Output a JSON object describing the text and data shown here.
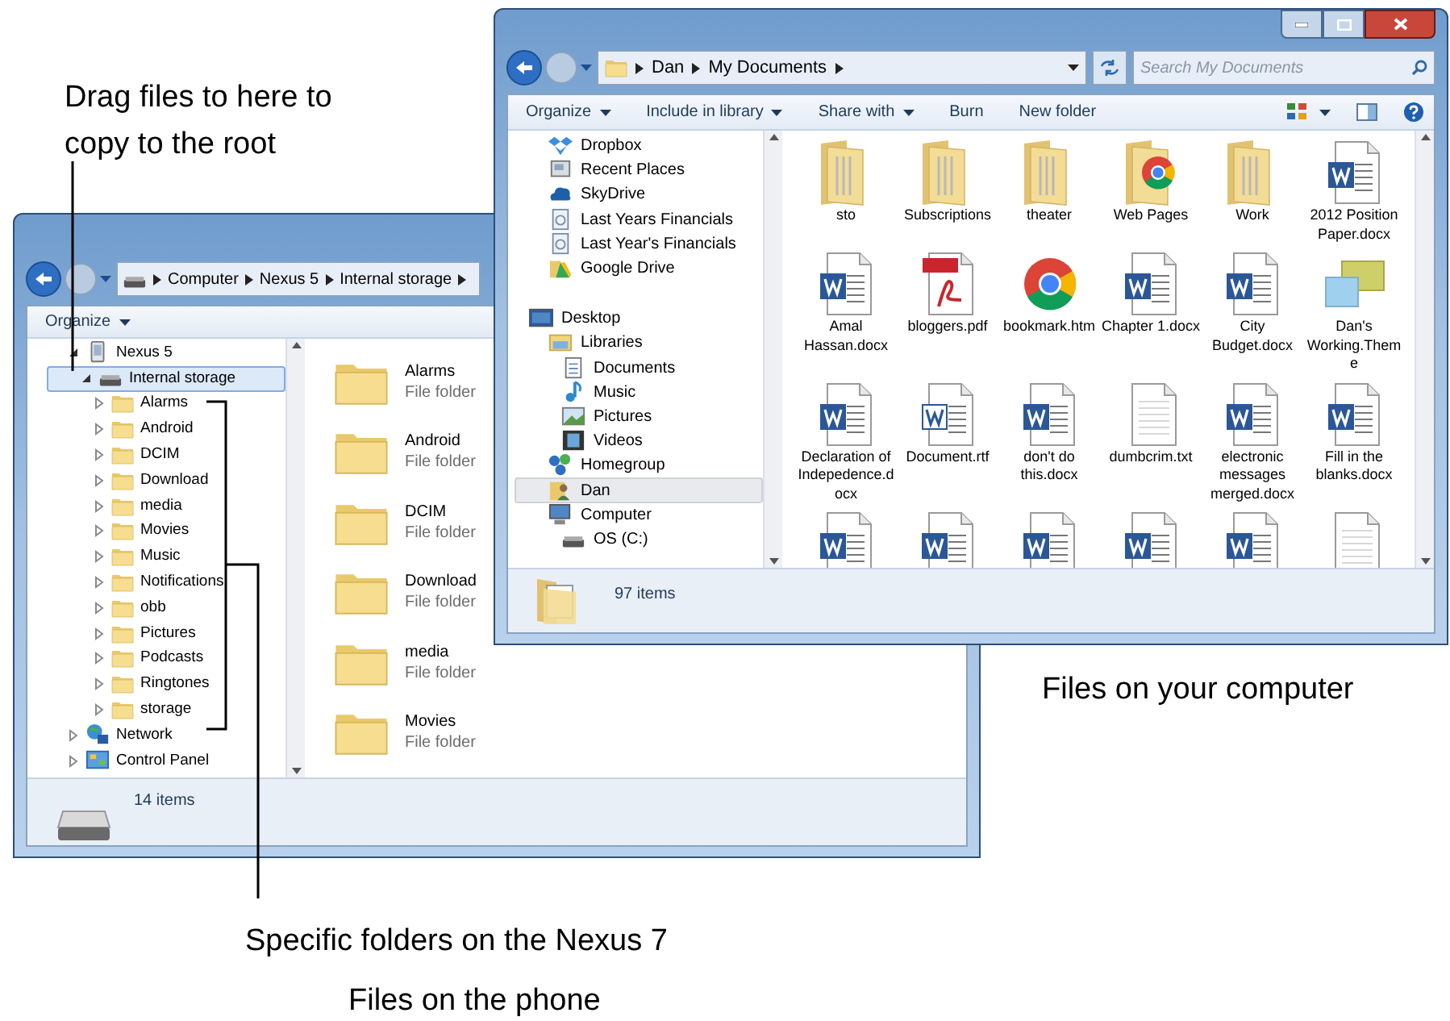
{
  "callouts": [
    {
      "text": "Drag files to here to copy to the root"
    },
    {
      "text": "Files on your computer"
    },
    {
      "text": "Specific folders on the Nexus 7"
    },
    {
      "text": "Files on the phone"
    }
  ],
  "phone_window": {
    "breadcrumb": [
      "Computer",
      "Nexus 5",
      "Internal storage"
    ],
    "toolbar": [
      {
        "label": "Organize",
        "menu": true
      }
    ],
    "nav_tree": [
      {
        "label": "Nexus 5",
        "kind": "phone",
        "expanded": true,
        "selected": false,
        "children": [
          {
            "label": "Internal storage",
            "kind": "drive",
            "expanded": true,
            "selected": true,
            "children": [
              {
                "label": "Alarms",
                "kind": "folder",
                "expanded": false,
                "selected": false
              },
              {
                "label": "Android",
                "kind": "folder",
                "expanded": false,
                "selected": false
              },
              {
                "label": "DCIM",
                "kind": "folder",
                "expanded": false,
                "selected": false
              },
              {
                "label": "Download",
                "kind": "folder",
                "expanded": false,
                "selected": false
              },
              {
                "label": "media",
                "kind": "folder",
                "expanded": false,
                "selected": false
              },
              {
                "label": "Movies",
                "kind": "folder",
                "expanded": false,
                "selected": false
              },
              {
                "label": "Music",
                "kind": "folder",
                "expanded": false,
                "selected": false
              },
              {
                "label": "Notifications",
                "kind": "folder",
                "expanded": false,
                "selected": false
              },
              {
                "label": "obb",
                "kind": "folder",
                "expanded": false,
                "selected": false
              },
              {
                "label": "Pictures",
                "kind": "folder",
                "expanded": false,
                "selected": false
              },
              {
                "label": "Podcasts",
                "kind": "folder",
                "expanded": false,
                "selected": false
              },
              {
                "label": "Ringtones",
                "kind": "folder",
                "expanded": false,
                "selected": false
              },
              {
                "label": "storage",
                "kind": "folder",
                "expanded": false,
                "selected": false
              }
            ]
          }
        ]
      },
      {
        "label": "Network",
        "kind": "network",
        "expanded": false,
        "selected": false
      },
      {
        "label": "Control Panel",
        "kind": "control-panel",
        "expanded": false,
        "selected": false
      }
    ],
    "items": [
      {
        "name": "Alarms",
        "type": "File folder"
      },
      {
        "name": "Android",
        "type": "File folder"
      },
      {
        "name": "DCIM",
        "type": "File folder"
      },
      {
        "name": "Download",
        "type": "File folder"
      },
      {
        "name": "media",
        "type": "File folder"
      },
      {
        "name": "Movies",
        "type": "File folder"
      }
    ],
    "status": "14 items"
  },
  "computer_window": {
    "breadcrumb": [
      "Dan",
      "My Documents"
    ],
    "search": {
      "placeholder": "Search My Documents"
    },
    "toolbar": [
      {
        "label": "Organize",
        "menu": true
      },
      {
        "label": "Include in library",
        "menu": true
      },
      {
        "label": "Share with",
        "menu": true
      },
      {
        "label": "Burn",
        "menu": false
      },
      {
        "label": "New folder",
        "menu": false
      }
    ],
    "nav": [
      {
        "items": [
          {
            "label": "Dropbox",
            "kind": "dropbox",
            "selected": false
          },
          {
            "label": "Recent Places",
            "kind": "recent",
            "selected": false
          },
          {
            "label": "SkyDrive",
            "kind": "cloud",
            "selected": false
          },
          {
            "label": "Last Years Financials",
            "kind": "shortcut",
            "selected": false
          },
          {
            "label": "Last Year's Financials",
            "kind": "shortcut",
            "selected": false
          },
          {
            "label": "Google Drive",
            "kind": "gdrive",
            "selected": false
          }
        ]
      },
      {
        "items": [
          {
            "label": "Desktop",
            "kind": "desktop",
            "selected": false
          },
          {
            "label": "Libraries",
            "kind": "library",
            "selected": false,
            "children": [
              {
                "label": "Documents",
                "kind": "documents",
                "selected": false
              },
              {
                "label": "Music",
                "kind": "music",
                "selected": false
              },
              {
                "label": "Pictures",
                "kind": "pictures",
                "selected": false
              },
              {
                "label": "Videos",
                "kind": "videos",
                "selected": false
              }
            ]
          },
          {
            "label": "Homegroup",
            "kind": "homegroup",
            "selected": false
          },
          {
            "label": "Dan",
            "kind": "user",
            "selected": true
          },
          {
            "label": "Computer",
            "kind": "computer",
            "selected": false,
            "children": [
              {
                "label": "OS (C:)",
                "kind": "drive",
                "selected": false
              }
            ]
          }
        ]
      }
    ],
    "items": [
      {
        "name": "sto",
        "kind": "folder"
      },
      {
        "name": "Subscriptions",
        "kind": "folder"
      },
      {
        "name": "theater",
        "kind": "folder"
      },
      {
        "name": "Web Pages",
        "kind": "chrome-folder"
      },
      {
        "name": "Work",
        "kind": "folder"
      },
      {
        "name": "2012 Position Paper.docx",
        "kind": "word"
      },
      {
        "name": "Amal Hassan.docx",
        "kind": "word"
      },
      {
        "name": "bloggers.pdf",
        "kind": "pdf"
      },
      {
        "name": "bookmark.htm",
        "kind": "chrome"
      },
      {
        "name": "Chapter 1.docx",
        "kind": "word"
      },
      {
        "name": "City Budget.docx",
        "kind": "word"
      },
      {
        "name": "Dan's Working.Theme",
        "kind": "theme"
      },
      {
        "name": "Declaration of Indepedence.docx",
        "kind": "word"
      },
      {
        "name": "Document.rtf",
        "kind": "rtf"
      },
      {
        "name": "don't do this.docx",
        "kind": "word"
      },
      {
        "name": "dumbcrim.txt",
        "kind": "text"
      },
      {
        "name": "electronic messages merged.docx",
        "kind": "word"
      },
      {
        "name": "Fill in the blanks.docx",
        "kind": "word"
      },
      {
        "kind": "word"
      },
      {
        "kind": "word"
      },
      {
        "kind": "word"
      },
      {
        "kind": "word"
      },
      {
        "kind": "word"
      },
      {
        "kind": "text"
      }
    ],
    "status": "97 items"
  }
}
